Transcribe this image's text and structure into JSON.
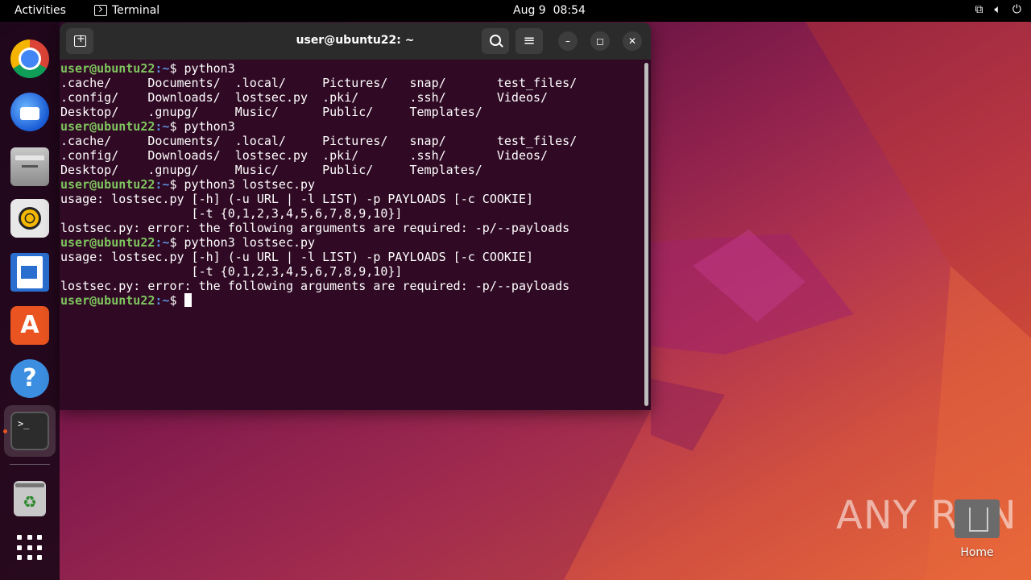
{
  "topbar": {
    "activities": "Activities",
    "app_name": "Terminal",
    "date": "Aug 9",
    "time": "08:54",
    "tray_icons": [
      "network-icon",
      "volume-icon",
      "power-icon"
    ]
  },
  "dock": {
    "items": [
      "chrome",
      "thunderbird",
      "files",
      "rhythmbox",
      "libreoffice-writer",
      "app-center",
      "help",
      "terminal",
      "trash",
      "show-apps"
    ],
    "running_indicator_color": "#e95420"
  },
  "window": {
    "title": "user@ubuntu22: ~"
  },
  "terminal": {
    "prompt_user": "user@ubuntu22",
    "prompt_path": ":~",
    "lines": [
      {
        "type": "prompt",
        "cmd": "$ python3"
      },
      {
        "type": "out",
        "text": ".cache/     Documents/  .local/     Pictures/   snap/       test_files/"
      },
      {
        "type": "out",
        "text": ".config/    Downloads/  lostsec.py  .pki/       .ssh/       Videos/"
      },
      {
        "type": "out",
        "text": "Desktop/    .gnupg/     Music/      Public/     Templates/"
      },
      {
        "type": "prompt",
        "cmd": "$ python3"
      },
      {
        "type": "out",
        "text": ".cache/     Documents/  .local/     Pictures/   snap/       test_files/"
      },
      {
        "type": "out",
        "text": ".config/    Downloads/  lostsec.py  .pki/       .ssh/       Videos/"
      },
      {
        "type": "out",
        "text": "Desktop/    .gnupg/     Music/      Public/     Templates/"
      },
      {
        "type": "prompt",
        "cmd": "$ python3 lostsec.py"
      },
      {
        "type": "out",
        "text": "usage: lostsec.py [-h] (-u URL | -l LIST) -p PAYLOADS [-c COOKIE]"
      },
      {
        "type": "out",
        "text": "                  [-t {0,1,2,3,4,5,6,7,8,9,10}]"
      },
      {
        "type": "out",
        "text": "lostsec.py: error: the following arguments are required: -p/--payloads"
      },
      {
        "type": "prompt",
        "cmd": "$ python3 lostsec.py"
      },
      {
        "type": "out",
        "text": "usage: lostsec.py [-h] (-u URL | -l LIST) -p PAYLOADS [-c COOKIE]"
      },
      {
        "type": "out",
        "text": "                  [-t {0,1,2,3,4,5,6,7,8,9,10}]"
      },
      {
        "type": "out",
        "text": "lostsec.py: error: the following arguments are required: -p/--payloads"
      },
      {
        "type": "prompt",
        "cmd": "$ ",
        "cursor": true
      }
    ]
  },
  "desktop": {
    "home_label": "Home",
    "watermark": "ANY RUN"
  },
  "colors": {
    "terminal_bg": "#300a24",
    "prompt_user": "#7fc65f",
    "prompt_path": "#5a8dd8",
    "titlebar": "#2b2b2b"
  }
}
